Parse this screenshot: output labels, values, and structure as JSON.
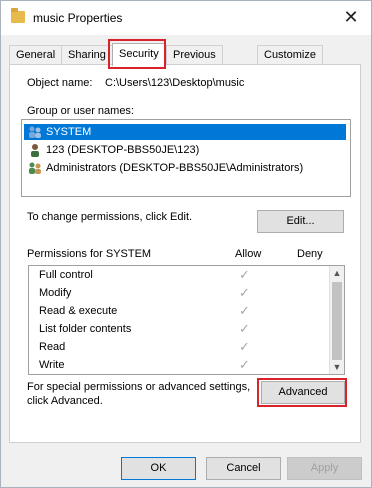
{
  "window": {
    "title": "music Properties",
    "close_glyph": "✕"
  },
  "tabs": [
    {
      "label": "General"
    },
    {
      "label": "Sharing"
    },
    {
      "label": "Security"
    },
    {
      "label": "Previous Versions"
    },
    {
      "label": "Customize"
    }
  ],
  "security": {
    "object_name_label": "Object name:",
    "object_name_value": "C:\\Users\\123\\Desktop\\music",
    "group_label": "Group or user names:",
    "users": [
      {
        "name": "SYSTEM",
        "icon": "group-icon",
        "selected": true
      },
      {
        "name": "123 (DESKTOP-BBS50JE\\123)",
        "icon": "user-icon",
        "selected": false
      },
      {
        "name": "Administrators (DESKTOP-BBS50JE\\Administrators)",
        "icon": "group-icon",
        "selected": false
      }
    ],
    "change_text": "To change permissions, click Edit.",
    "edit_label": "Edit...",
    "permissions_header": "Permissions for SYSTEM",
    "allow_header": "Allow",
    "deny_header": "Deny",
    "permissions": [
      {
        "name": "Full control",
        "allow": "✓"
      },
      {
        "name": "Modify",
        "allow": "✓"
      },
      {
        "name": "Read & execute",
        "allow": "✓"
      },
      {
        "name": "List folder contents",
        "allow": "✓"
      },
      {
        "name": "Read",
        "allow": "✓"
      },
      {
        "name": "Write",
        "allow": "✓"
      }
    ],
    "special_text_1": "For special permissions or advanced settings,",
    "special_text_2": "click Advanced.",
    "advanced_label": "Advanced"
  },
  "footer": {
    "ok_label": "OK",
    "cancel_label": "Cancel",
    "apply_label": "Apply"
  },
  "colors": {
    "highlight": "#d9232a",
    "selection": "#0078d7"
  }
}
